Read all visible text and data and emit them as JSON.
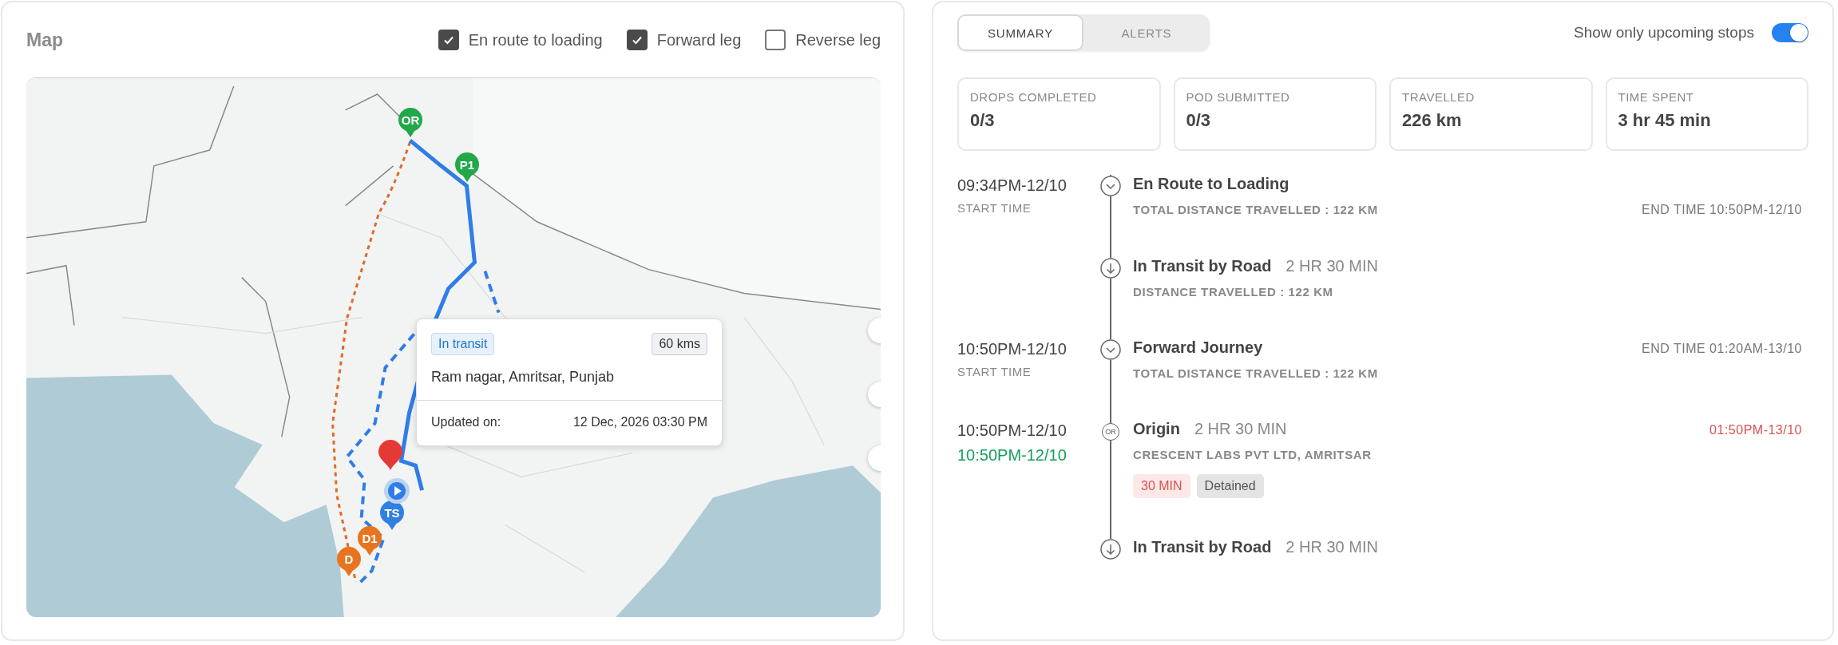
{
  "map": {
    "title": "Map",
    "filters": [
      {
        "label": "En route to loading",
        "checked": true
      },
      {
        "label": "Forward leg",
        "checked": true
      },
      {
        "label": "Reverse leg",
        "checked": false
      }
    ],
    "markers": [
      {
        "label": "OR",
        "color": "#22a84a"
      },
      {
        "label": "P1",
        "color": "#22a84a"
      },
      {
        "label": "TS",
        "color": "#2f80e0"
      },
      {
        "label": "D1",
        "color": "#e8741f"
      },
      {
        "label": "D",
        "color": "#e8741f"
      }
    ],
    "tooltip": {
      "status": "In transit",
      "distance": "60 kms",
      "address": "Ram nagar, Amritsar, Punjab",
      "updated_label": "Updated on:",
      "updated_value": "12 Dec, 2026 03:30 PM"
    }
  },
  "tabs": [
    {
      "label": "SUMMARY",
      "selected": true
    },
    {
      "label": "ALERTS",
      "selected": false
    }
  ],
  "upcoming_toggle": {
    "label": "Show only upcoming stops",
    "on": true
  },
  "stats": [
    {
      "label": "DROPS COMPLETED",
      "value": "0/3"
    },
    {
      "label": "POD SUBMITTED",
      "value": "0/3"
    },
    {
      "label": "TRAVELLED",
      "value": "226 km"
    },
    {
      "label": "TIME SPENT",
      "value": "3 hr 45 min"
    }
  ],
  "timeline": [
    {
      "kind": "stage",
      "time": "09:34PM-12/10",
      "time_label": "START TIME",
      "title": "En Route to Loading",
      "detail": "TOTAL DISTANCE TRAVELLED : 122 KM",
      "detail_right": "END TIME 10:50PM-12/10"
    },
    {
      "kind": "transit",
      "title": "In Transit by Road",
      "duration": "2 HR 30 MIN",
      "detail": "DISTANCE TRAVELLED : 122 KM"
    },
    {
      "kind": "stage",
      "time": "10:50PM-12/10",
      "time_label": "START TIME",
      "title": "Forward Journey",
      "title_right": "END TIME 01:20AM-13/10",
      "detail": "TOTAL DISTANCE TRAVELLED : 122 KM"
    },
    {
      "kind": "stop",
      "marker": "OR",
      "time": "10:50PM-12/10",
      "actual_time": "10:50PM-12/10",
      "on_time": true,
      "title": "Origin",
      "duration": "2 HR 30 MIN",
      "title_right": "01:50PM-13/10",
      "late": true,
      "detail": "CRESCENT LABS PVT LTD, AMRITSAR",
      "tags": [
        {
          "text": "30 MIN",
          "kind": "delay"
        },
        {
          "text": "Detained",
          "kind": "status"
        }
      ]
    },
    {
      "kind": "transit",
      "title": "In Transit by Road",
      "duration": "2 HR 30 MIN"
    }
  ]
}
